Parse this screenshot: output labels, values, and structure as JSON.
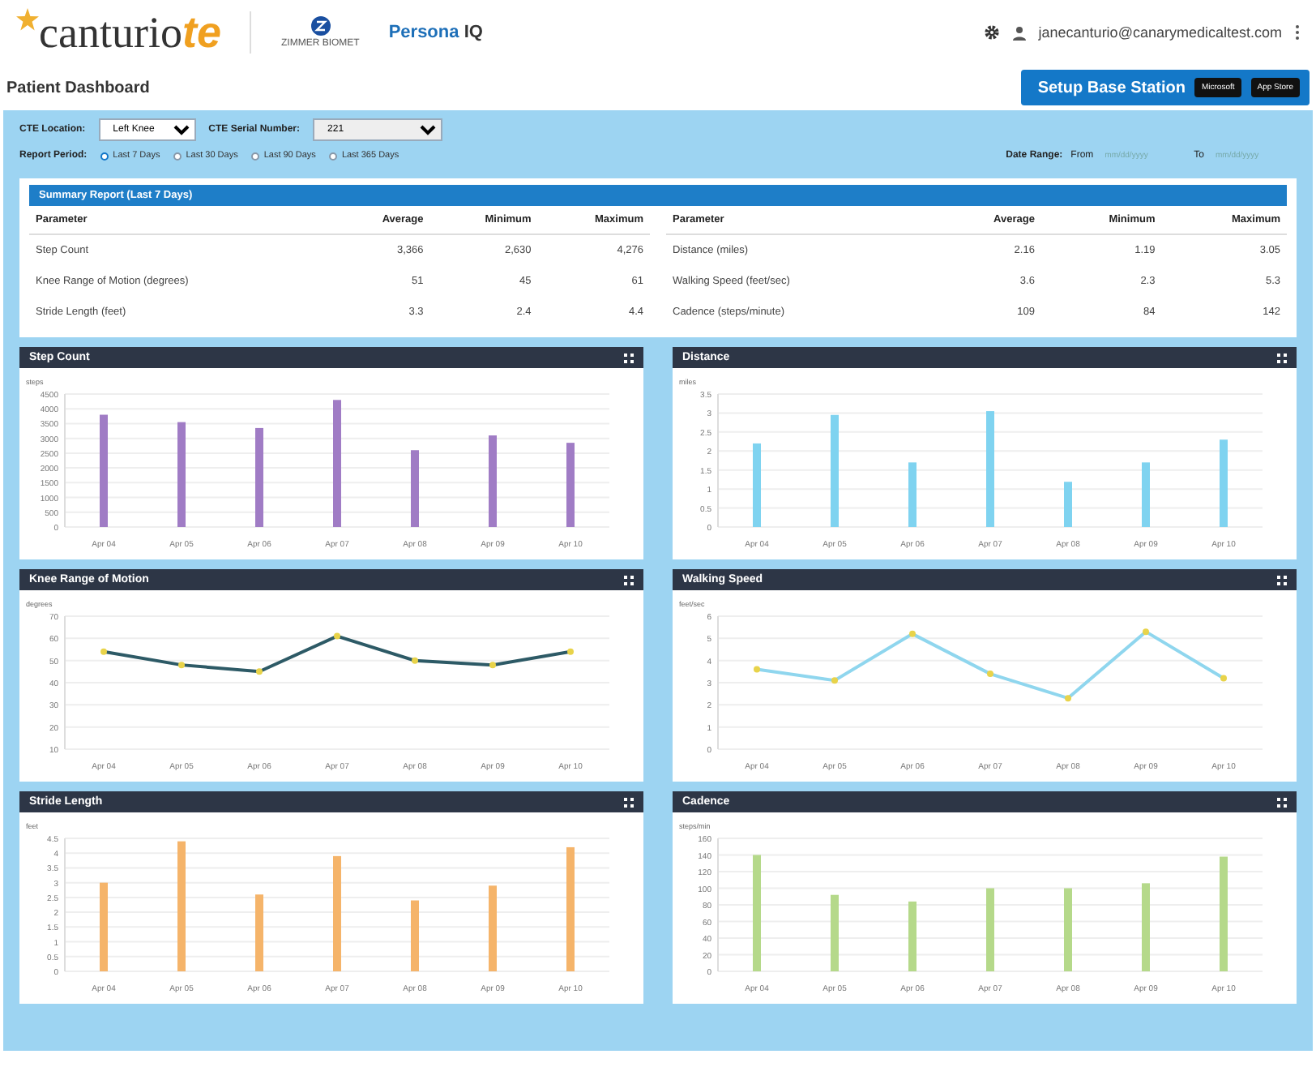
{
  "header": {
    "logo_main": "canturio",
    "logo_accent": "te",
    "partner": "ZIMMER BIOMET",
    "product_main": "Persona",
    "product_accent": "IQ",
    "user_email": "janecanturio@canarymedicaltest.com"
  },
  "page_title": "Patient Dashboard",
  "setup_button": {
    "label": "Setup Base Station",
    "badges": [
      "Microsoft",
      "App Store"
    ]
  },
  "filters": {
    "location_label": "CTE Location:",
    "location_value": "Left Knee",
    "serial_label": "CTE Serial Number:",
    "serial_value": "221",
    "period_label": "Report Period:",
    "periods": [
      {
        "label": "Last 7 Days",
        "selected": true
      },
      {
        "label": "Last 30 Days",
        "selected": false
      },
      {
        "label": "Last 90 Days",
        "selected": false
      },
      {
        "label": "Last 365 Days",
        "selected": false
      }
    ],
    "date_range_label": "Date Range:",
    "from_label": "From",
    "from_placeholder": "mm/dd/yyyy",
    "to_label": "To",
    "to_placeholder": "mm/dd/yyyy"
  },
  "summary": {
    "title": "Summary Report (Last 7 Days)",
    "left_columns": [
      "Parameter",
      "Average",
      "Minimum",
      "Maximum"
    ],
    "right_columns": [
      "Parameter",
      "Average",
      "Minimum",
      "Maximum"
    ],
    "left_rows": [
      [
        "Step Count",
        "3,366",
        "2,630",
        "4,276"
      ],
      [
        "Knee Range of Motion (degrees)",
        "51",
        "45",
        "61"
      ],
      [
        "Stride Length (feet)",
        "3.3",
        "2.4",
        "4.4"
      ]
    ],
    "right_rows": [
      [
        "Distance (miles)",
        "2.16",
        "1.19",
        "3.05"
      ],
      [
        "Walking Speed (feet/sec)",
        "3.6",
        "2.3",
        "5.3"
      ],
      [
        "Cadence (steps/minute)",
        "109",
        "84",
        "142"
      ]
    ]
  },
  "charts": [
    {
      "title": "Step Count",
      "chart_data": {
        "type": "bar",
        "ylabel": "steps",
        "categories": [
          "Apr 04",
          "Apr 05",
          "Apr 06",
          "Apr 07",
          "Apr 08",
          "Apr 09",
          "Apr 10"
        ],
        "grid": true,
        "series": [
          {
            "color": "#a07cc5",
            "values": [
              3800,
              3550,
              3350,
              4300,
              2600,
              3100,
              2850
            ]
          }
        ],
        "ylim": [
          0,
          4500
        ],
        "yticks": [
          0,
          500,
          1000,
          1500,
          2000,
          2500,
          3000,
          3500,
          4000,
          4500
        ]
      }
    },
    {
      "title": "Distance",
      "chart_data": {
        "type": "bar",
        "ylabel": "miles",
        "categories": [
          "Apr 04",
          "Apr 05",
          "Apr 06",
          "Apr 07",
          "Apr 08",
          "Apr 09",
          "Apr 10"
        ],
        "grid": true,
        "series": [
          {
            "color": "#7fd3f0",
            "values": [
              2.2,
              2.95,
              1.7,
              3.05,
              1.19,
              1.7,
              2.3
            ]
          }
        ],
        "ylim": [
          0,
          3.5
        ],
        "yticks": [
          0,
          0.5,
          1,
          1.5,
          2,
          2.5,
          3,
          3.5
        ]
      }
    },
    {
      "title": "Knee Range of Motion",
      "chart_data": {
        "type": "line",
        "ylabel": "degrees",
        "categories": [
          "Apr 04",
          "Apr 05",
          "Apr 06",
          "Apr 07",
          "Apr 08",
          "Apr 09",
          "Apr 10"
        ],
        "grid": true,
        "series": [
          {
            "color": "#2d5a66",
            "marker": true,
            "values": [
              54,
              48,
              45,
              61,
              50,
              48,
              54
            ]
          }
        ],
        "ylim": [
          10,
          70
        ],
        "yticks": [
          10,
          20,
          30,
          40,
          50,
          60,
          70
        ]
      }
    },
    {
      "title": "Walking Speed",
      "chart_data": {
        "type": "line",
        "ylabel": "feet/sec",
        "categories": [
          "Apr 04",
          "Apr 05",
          "Apr 06",
          "Apr 07",
          "Apr 08",
          "Apr 09",
          "Apr 10"
        ],
        "grid": true,
        "series": [
          {
            "color": "#8fd6ee",
            "marker": true,
            "values": [
              3.6,
              3.1,
              5.2,
              3.4,
              2.3,
              5.3,
              3.2
            ]
          }
        ],
        "ylim": [
          0,
          6
        ],
        "yticks": [
          0,
          1,
          2,
          3,
          4,
          5,
          6
        ]
      }
    },
    {
      "title": "Stride Length",
      "chart_data": {
        "type": "bar",
        "ylabel": "feet",
        "categories": [
          "Apr 04",
          "Apr 05",
          "Apr 06",
          "Apr 07",
          "Apr 08",
          "Apr 09",
          "Apr 10"
        ],
        "grid": true,
        "series": [
          {
            "color": "#f5b46a",
            "values": [
              3.0,
              4.4,
              2.6,
              3.9,
              2.4,
              2.9,
              4.2
            ]
          }
        ],
        "ylim": [
          0,
          4.5
        ],
        "yticks": [
          0,
          0.5,
          1,
          1.5,
          2,
          2.5,
          3,
          3.5,
          4,
          4.5
        ]
      }
    },
    {
      "title": "Cadence",
      "chart_data": {
        "type": "bar",
        "ylabel": "steps/min",
        "categories": [
          "Apr 04",
          "Apr 05",
          "Apr 06",
          "Apr 07",
          "Apr 08",
          "Apr 09",
          "Apr 10"
        ],
        "grid": true,
        "series": [
          {
            "color": "#b5d98a",
            "values": [
              140,
              92,
              84,
              100,
              100,
              106,
              138
            ]
          }
        ],
        "ylim": [
          0,
          160
        ],
        "yticks": [
          0,
          20,
          40,
          60,
          80,
          100,
          120,
          140,
          160
        ]
      }
    }
  ]
}
